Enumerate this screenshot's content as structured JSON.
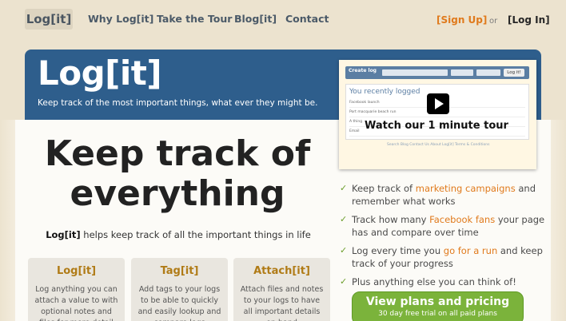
{
  "nav": {
    "logo": "Log[it]",
    "links": [
      "Why Log[it]",
      "Take the Tour",
      "Blog[it]",
      "Contact"
    ],
    "signup": "[Sign Up]",
    "or": "or",
    "login": "[Log In]"
  },
  "banner": {
    "title": "Log[it]",
    "tagline": "Keep track of the most important things, what ever they might be."
  },
  "hero": {
    "headline_1": "Keep track of",
    "headline_2": "everything",
    "sub_brand": "Log[it]",
    "sub_rest": " helps keep track of all the important things in life"
  },
  "cards": [
    {
      "title": "Log[it]",
      "text": "Log anything you can attach a value to with optional notes and files for more detail"
    },
    {
      "title": "Tag[it]",
      "text": "Add tags to your logs to be able to quickly and easily lookup and compare logs"
    },
    {
      "title": "Attach[it]",
      "text": "Attach files and notes to your logs to have all important details on hand"
    }
  ],
  "video": {
    "bar_label": "Create log",
    "log_button": "Log it!",
    "recent_title": "You recently logged",
    "rows": [
      "Facebook launch",
      "Port macquarie beach run",
      "A thing",
      "Email"
    ],
    "footer": "Search   Blog   Contact Us   About Log[it]   Terms & Conditions",
    "caption": "Watch our 1 minute tour"
  },
  "features": [
    {
      "pre": "Keep track of ",
      "hl": "marketing campaigns",
      "post": " and remember what works"
    },
    {
      "pre": "Track how many ",
      "hl": "Facebook fans",
      "post": " your page has and compare over time"
    },
    {
      "pre": "Log every time you ",
      "hl": "go for a run",
      "post": " and keep track of your progress"
    },
    {
      "pre": "Plus anything else you can think of!",
      "hl": "",
      "post": ""
    }
  ],
  "cta": {
    "main": "View plans and pricing",
    "sub": "30 day free trial on all paid plans"
  },
  "colors": {
    "background": "#ece3cf",
    "banner": "#2e5e8c",
    "accent_orange": "#e07a1c",
    "accent_gold": "#b07b16",
    "cta_green": "#7bb33b",
    "check_green": "#6b9e2b"
  },
  "icons": [
    "check-icon",
    "play-icon"
  ]
}
